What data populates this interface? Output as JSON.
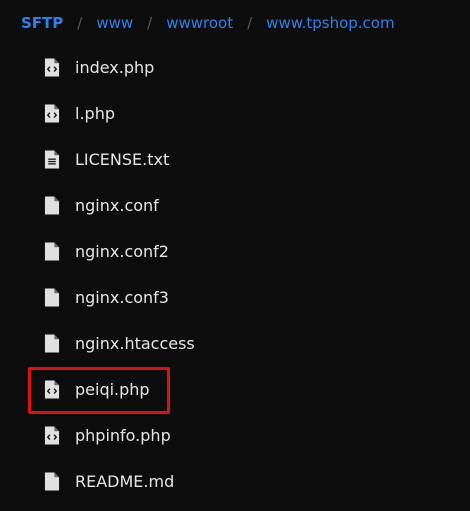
{
  "breadcrumb": {
    "items": [
      "SFTP",
      "www",
      "wwwroot",
      "www.tpshop.com"
    ],
    "separator": "/"
  },
  "files": [
    {
      "name": "index.php",
      "icon": "code-file-icon"
    },
    {
      "name": "l.php",
      "icon": "code-file-icon"
    },
    {
      "name": "LICENSE.txt",
      "icon": "text-file-icon"
    },
    {
      "name": "nginx.conf",
      "icon": "file-icon"
    },
    {
      "name": "nginx.conf2",
      "icon": "file-icon"
    },
    {
      "name": "nginx.conf3",
      "icon": "file-icon"
    },
    {
      "name": "nginx.htaccess",
      "icon": "file-icon"
    },
    {
      "name": "peiqi.php",
      "icon": "code-file-icon",
      "highlighted": true
    },
    {
      "name": "phpinfo.php",
      "icon": "code-file-icon"
    },
    {
      "name": "README.md",
      "icon": "file-icon"
    }
  ],
  "colors": {
    "background": "#0d0d0d",
    "link": "#2f80ed",
    "text": "#e6e6e6",
    "separator": "#5a5a5a",
    "highlight": "#e01010",
    "icon": "#e0e0e0"
  }
}
